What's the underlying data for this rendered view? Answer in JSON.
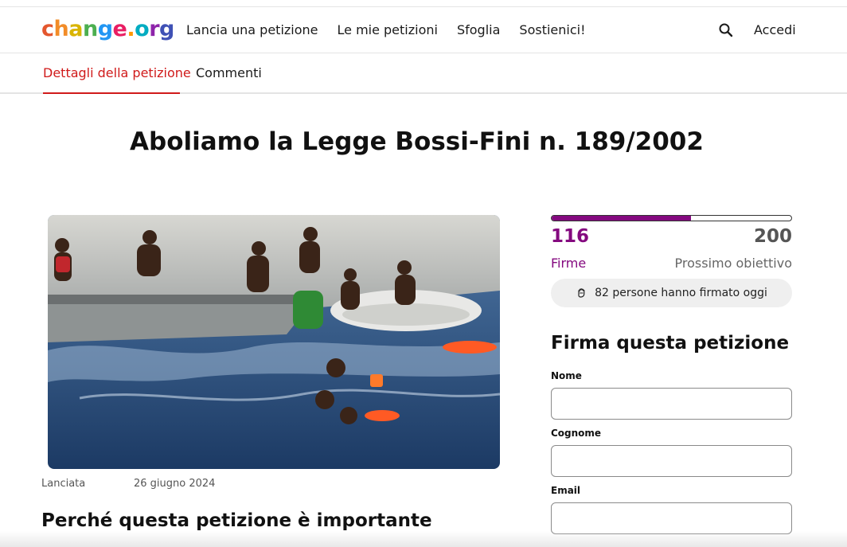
{
  "header": {
    "logo": "change.org",
    "nav": [
      "Lancia una petizione",
      "Le mie petizioni",
      "Sfoglia",
      "Sostienici!"
    ],
    "login_label": "Accedi",
    "search_icon": "search-icon"
  },
  "tabs": {
    "details": "Dettagli della petizione",
    "comments": "Commenti"
  },
  "petition": {
    "title": "Aboliamo la Legge Bossi-Fini n. 189/2002",
    "image_alt": "Persone in mare vicino a un gommone e a una nave",
    "launched_label": "Lanciata",
    "launched_date": "26 giugno 2024",
    "why_heading": "Perché questa petizione è importante"
  },
  "signatures": {
    "count": "116",
    "count_label": "Firme",
    "goal": "200",
    "goal_label": "Prossimo obiettivo",
    "progress_fraction": 0.58,
    "today_text": "82 persone hanno firmato oggi",
    "brand_color": "#84097f"
  },
  "form": {
    "heading": "Firma questa petizione",
    "first_name_label": "Nome",
    "last_name_label": "Cognome",
    "email_label": "Email"
  }
}
